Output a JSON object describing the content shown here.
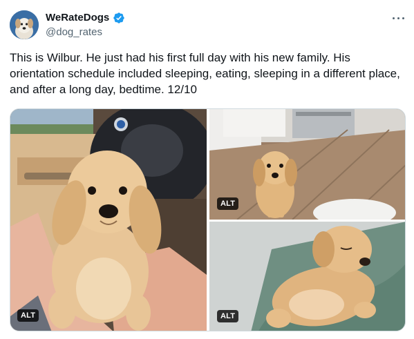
{
  "author": {
    "display_name": "WeRateDogs",
    "handle": "@dog_rates",
    "verified": true,
    "avatar_icon": "dog-avatar-icon"
  },
  "tweet": {
    "text": "This is Wilbur. He just had his first full day with his new family. His orientation schedule included sleeping, eating, sleeping in a different place, and after a long day, bedtime. 12/10"
  },
  "media": [
    {
      "alt_label": "ALT",
      "subject": "puppy-held-in-car"
    },
    {
      "alt_label": "ALT",
      "subject": "puppy-on-kitchen-floor"
    },
    {
      "alt_label": "ALT",
      "subject": "puppy-sleeping-in-bed"
    }
  ],
  "colors": {
    "verified_badge": "#1d9bf0",
    "secondary_text": "#536471",
    "primary_text": "#0f1419"
  }
}
